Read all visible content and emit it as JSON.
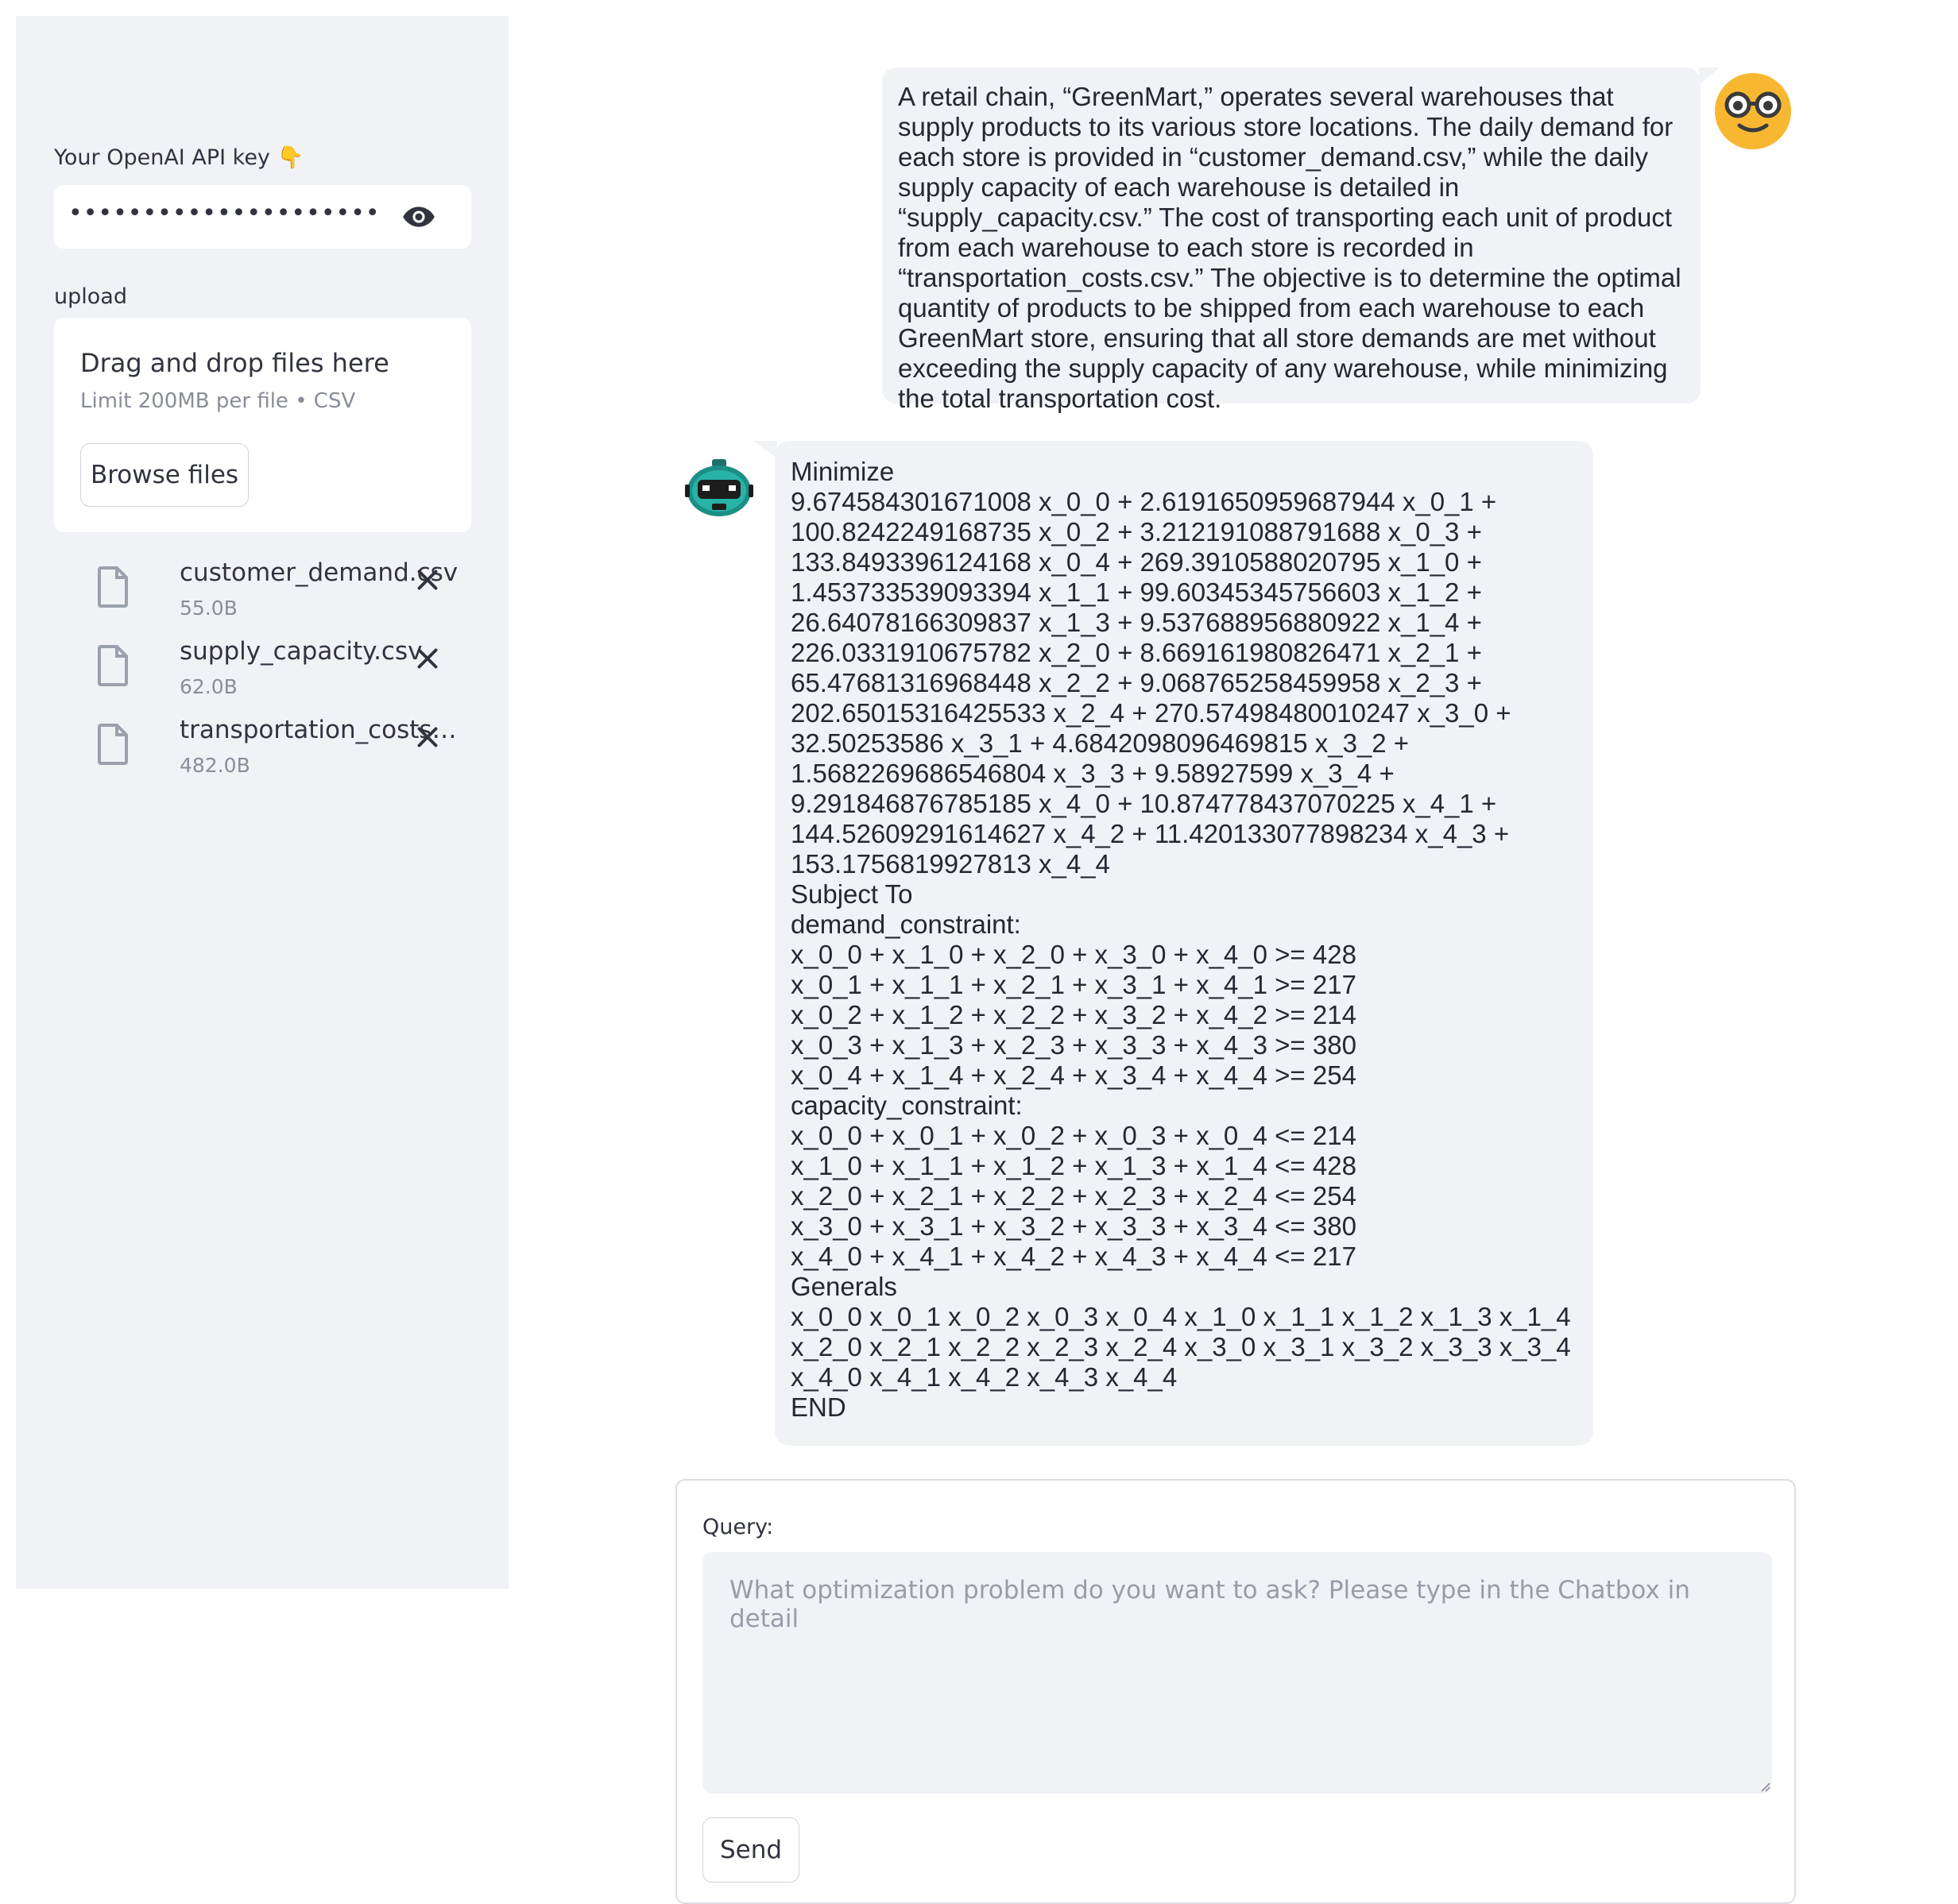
{
  "sidebar": {
    "api_key_label": "Your OpenAI API key 👇",
    "api_key_value": "•••••••••••••••••••••••••••••••••••••",
    "upload_label": "upload",
    "dropzone": {
      "title": "Drag and drop files here",
      "limit": "Limit 200MB per file • CSV",
      "browse_label": "Browse files"
    },
    "files": [
      {
        "name": "customer_demand.csv",
        "size": "55.0B"
      },
      {
        "name": "supply_capacity.csv",
        "size": "62.0B"
      },
      {
        "name": "transportation_costs…",
        "size": "482.0B"
      }
    ]
  },
  "chat": {
    "user_message": "A retail chain, “GreenMart,” operates several warehouses that supply products to its various store locations. The daily demand for each store is provided in “customer_demand.csv,” while the daily supply capacity of each warehouse is detailed in “supply_capacity.csv.” The cost of transporting each unit of product from each warehouse to each store is recorded in “transportation_costs.csv.” The objective is to determine the optimal quantity of products to be shipped from each warehouse to each GreenMart store, ensuring that all store demands are met without exceeding the supply capacity of any warehouse, while minimizing the total transportation cost.",
    "user_avatar_icon": "nerd-face-icon",
    "bot_avatar_icon": "robot-icon",
    "bot_lines": [
      "Minimize",
      "9.674584301671008 x_0_0 + 2.6191650959687944 x_0_1 +",
      "100.8242249168735 x_0_2 + 3.212191088791688 x_0_3 +",
      "133.8493396124168 x_0_4 + 269.3910588020795 x_1_0 +",
      "1.453733539093394 x_1_1 + 99.60345345756603 x_1_2 +",
      "26.64078166309837 x_1_3 + 9.537688956880922 x_1_4 +",
      "226.0331910675782 x_2_0 + 8.669161980826471 x_2_1 +",
      "65.47681316968448 x_2_2 + 9.068765258459958 x_2_3 +",
      "202.65015316425533 x_2_4 + 270.57498480010247 x_3_0 +",
      "32.50253586 x_3_1 + 4.6842098096469815 x_3_2 +",
      "1.5682269686546804 x_3_3 + 9.58927599 x_3_4 +",
      "9.291846876785185 x_4_0 + 10.874778437070225 x_4_1 +",
      "144.52609291614627 x_4_2 + 11.420133077898234 x_4_3 +",
      "153.1756819927813 x_4_4",
      "Subject To",
      "demand_constraint:",
      "x_0_0 + x_1_0 + x_2_0 + x_3_0 + x_4_0 >= 428",
      "x_0_1 + x_1_1 + x_2_1 + x_3_1 + x_4_1 >= 217",
      "x_0_2 + x_1_2 + x_2_2 + x_3_2 + x_4_2 >= 214",
      "x_0_3 + x_1_3 + x_2_3 + x_3_3 + x_4_3 >= 380",
      "x_0_4 + x_1_4 + x_2_4 + x_3_4 + x_4_4 >= 254",
      "capacity_constraint:",
      "x_0_0 + x_0_1 + x_0_2 + x_0_3 + x_0_4 <= 214",
      "x_1_0 + x_1_1 + x_1_2 + x_1_3 + x_1_4 <= 428",
      "x_2_0 + x_2_1 + x_2_2 + x_2_3 + x_2_4 <= 254",
      "x_3_0 + x_3_1 + x_3_2 + x_3_3 + x_3_4 <= 380",
      "x_4_0 + x_4_1 + x_4_2 + x_4_3 + x_4_4 <= 217",
      "Generals",
      "x_0_0 x_0_1 x_0_2 x_0_3 x_0_4 x_1_0 x_1_1 x_1_2 x_1_3 x_1_4",
      "x_2_0 x_2_1 x_2_2 x_2_3 x_2_4 x_3_0 x_3_1 x_3_2 x_3_3 x_3_4",
      "x_4_0 x_4_1 x_4_2 x_4_3 x_4_4",
      "END"
    ]
  },
  "query": {
    "label": "Query:",
    "placeholder": "What optimization problem do you want to ask? Please type in the Chatbox in detail",
    "value": "",
    "send_label": "Send"
  },
  "colors": {
    "sidebar_bg": "#f0f2f6",
    "bubble_bg": "#f0f2f6",
    "text": "#262730",
    "muted": "#8a8d98"
  }
}
